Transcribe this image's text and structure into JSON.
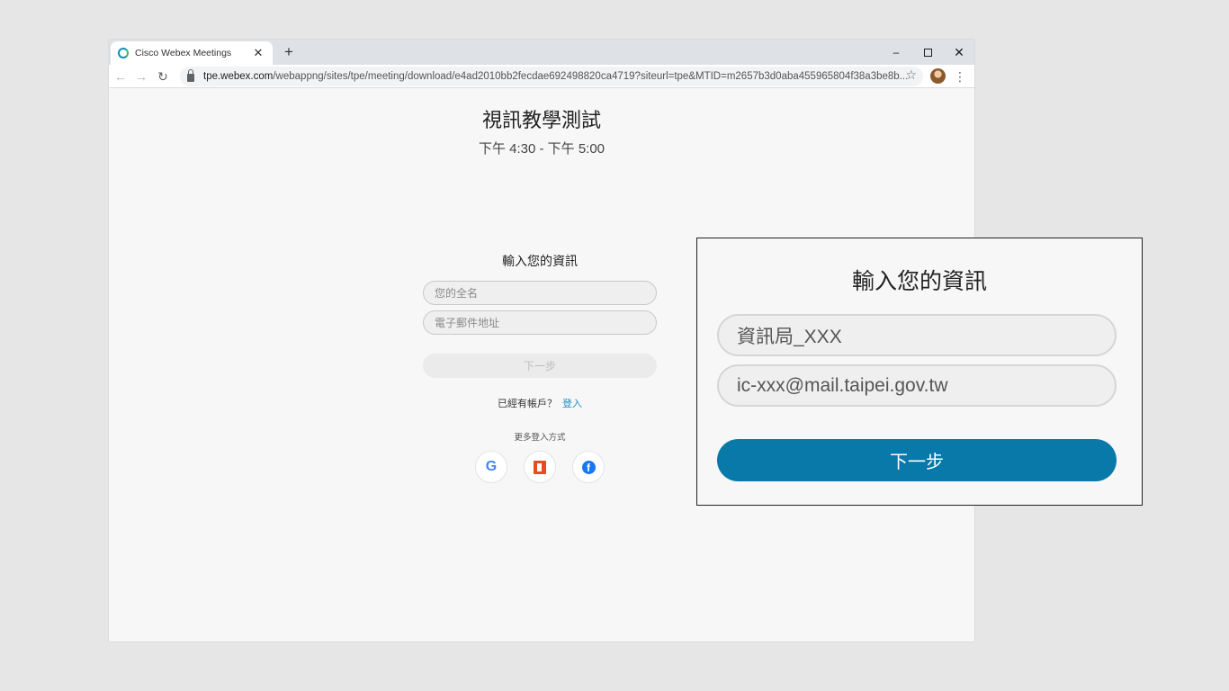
{
  "browser": {
    "tab_title": "Cisco Webex Meetings",
    "tab_close": "✕",
    "new_tab": "+",
    "url_host": "tpe.webex.com",
    "url_path": "/webappng/sites/tpe/meeting/download/e4ad2010bb2fecdae692498820ca4719?siteurl=tpe&MTID=m2657b3d0aba455965804f38a3be8b...",
    "window_controls": {
      "minimize": "–",
      "close": "✕"
    }
  },
  "meeting": {
    "title": "視訊教學測試",
    "time": "下午 4:30 - 下午 5:00"
  },
  "form": {
    "heading": "輸入您的資訊",
    "name_placeholder": "您的全名",
    "email_placeholder": "電子郵件地址",
    "next_label": "下一步",
    "have_account": "已經有帳戶？",
    "signin_label": "登入",
    "more_login": "更多登入方式",
    "social": [
      "google-icon",
      "office-icon",
      "facebook-icon"
    ]
  },
  "callout": {
    "heading": "輸入您的資訊",
    "name_value": "資訊局_XXX",
    "email_value": "ic-xxx@mail.taipei.gov.tw",
    "next_label": "下一步"
  },
  "colors": {
    "accent": "#0879a8",
    "link": "#1d8dc6",
    "page_bg": "#f7f7f7",
    "backdrop": "#e6e6e6"
  }
}
